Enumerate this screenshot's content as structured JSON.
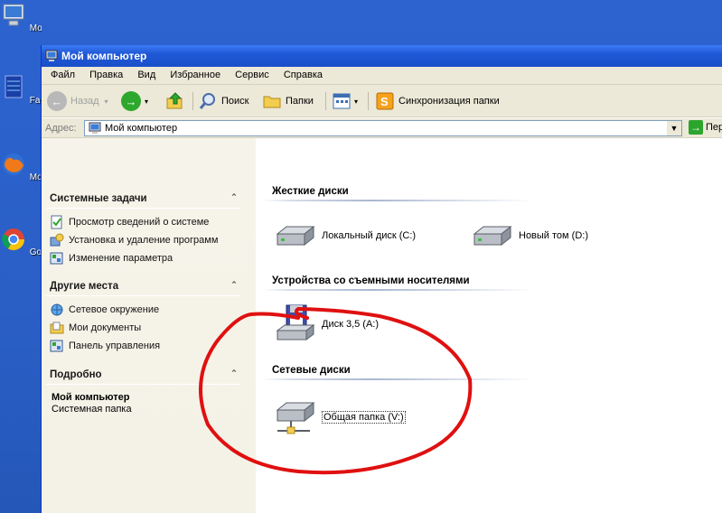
{
  "desktop": {
    "icons": [
      {
        "label": "Мой компьют",
        "icon": "my-computer-icon"
      },
      {
        "label": "Far Mana",
        "icon": "far-manager-icon"
      },
      {
        "label": "Mozilla Fi",
        "icon": "firefox-icon"
      },
      {
        "label": "Google C",
        "icon": "chrome-icon"
      }
    ]
  },
  "window": {
    "title": "Мой компьютер",
    "menu": [
      "Файл",
      "Правка",
      "Вид",
      "Избранное",
      "Сервис",
      "Справка"
    ],
    "toolbar": {
      "back": "Назад",
      "search": "Поиск",
      "folders": "Папки",
      "sync": "Синхронизация папки"
    },
    "address": {
      "label": "Адрес:",
      "value": "Мой компьютер",
      "go": "Пер"
    }
  },
  "leftpane": {
    "system_tasks": {
      "title": "Системные задачи",
      "items": [
        "Просмотр сведений о системе",
        "Установка и удаление программ",
        "Изменение параметра"
      ]
    },
    "other_places": {
      "title": "Другие места",
      "items": [
        "Сетевое окружение",
        "Мои документы",
        "Панель управления"
      ]
    },
    "details": {
      "title": "Подробно",
      "name": "Мой компьютер",
      "type": "Системная папка"
    }
  },
  "content": {
    "hard_drives": {
      "title": "Жесткие диски",
      "items": [
        "Локальный диск (C:)",
        "Новый том (D:)"
      ]
    },
    "removable": {
      "title": "Устройства со съемными носителями",
      "items": [
        "Диск 3,5 (A:)"
      ]
    },
    "network": {
      "title": "Сетевые диски",
      "items": [
        "Общая папка (V:)"
      ]
    }
  },
  "colors": {
    "desktop_blue": "#2a5fc6",
    "titlebar_blue": "#1f58d6",
    "annotation_red": "#e01010",
    "chrome": "#ece9d8"
  }
}
